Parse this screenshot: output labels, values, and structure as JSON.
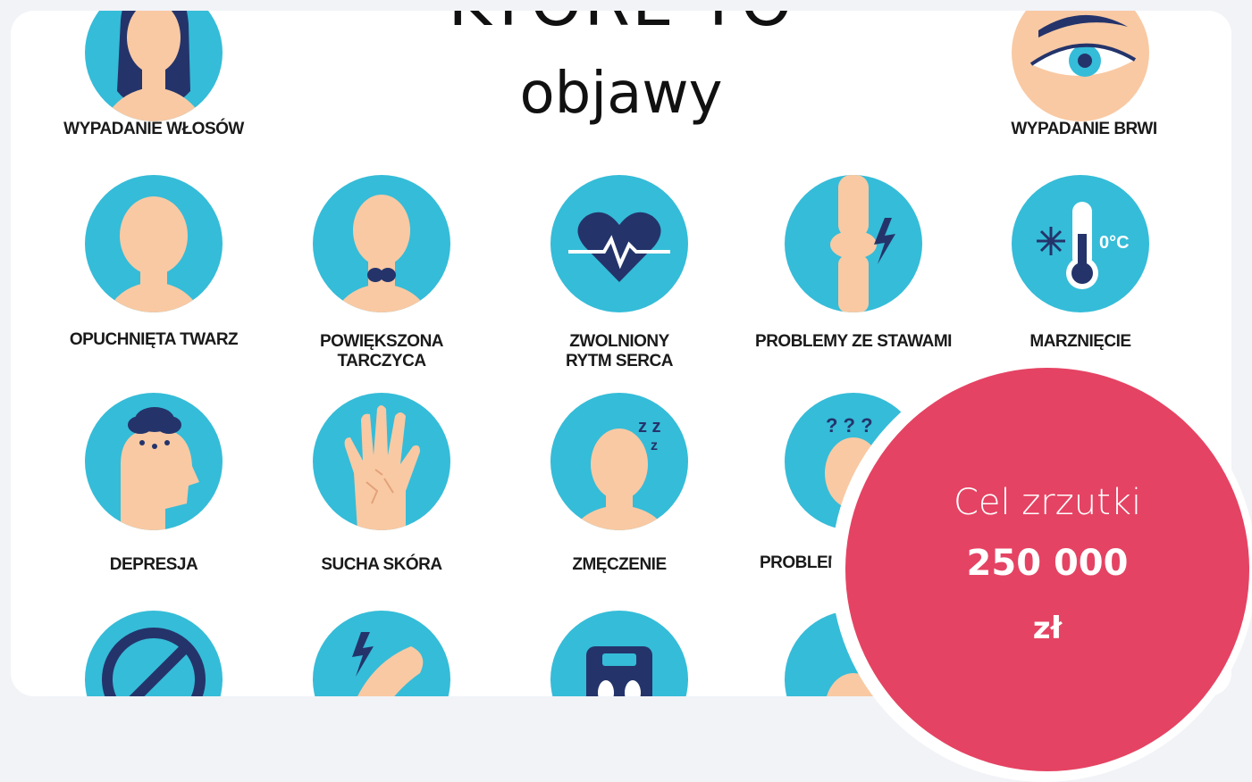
{
  "poster": {
    "title_partial": "KTORE TO",
    "title": "objawy",
    "symptoms": [
      {
        "label": "WYPADANIE WŁOSÓW",
        "icon": "hair-loss-icon"
      },
      {
        "label": "WYPADANIE BRWI",
        "icon": "eyebrow-loss-icon"
      },
      {
        "label": "OPUCHNIĘTA TWARZ",
        "icon": "swollen-face-icon"
      },
      {
        "label": "POWIĘKSZONA\nTARCZYCA",
        "icon": "enlarged-thyroid-icon"
      },
      {
        "label": "ZWOLNIONY\nRYTM SERCA",
        "icon": "heart-rate-icon"
      },
      {
        "label": "PROBLEMY ZE STAWAMI",
        "icon": "joint-problems-icon"
      },
      {
        "label": "MARZNIĘCIE",
        "icon": "thermometer-cold-icon"
      },
      {
        "label": "DEPRESJA",
        "icon": "depression-icon"
      },
      {
        "label": "SUCHA SKÓRA",
        "icon": "dry-skin-icon"
      },
      {
        "label": "ZMĘCZENIE",
        "icon": "fatigue-icon"
      },
      {
        "label": "PROBLEM",
        "icon": "memory-problems-icon"
      }
    ]
  },
  "badge": {
    "label": "Cel zrzutki",
    "amount": "250 000",
    "currency": "zł",
    "color": "#e54363"
  },
  "colors": {
    "icon_circle": "#35bcd8",
    "skin": "#f9c9a3",
    "navy": "#24346b"
  }
}
